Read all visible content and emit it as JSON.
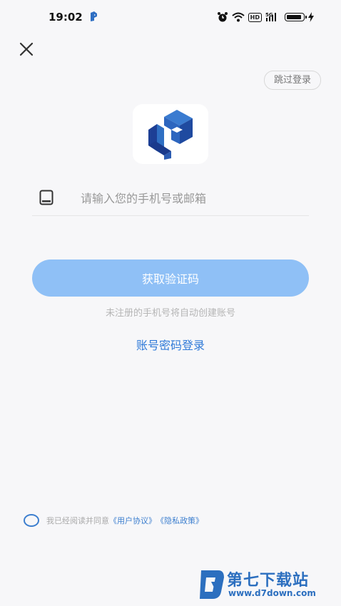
{
  "status_bar": {
    "time": "19:02",
    "hd_badge": "HD",
    "network": "5G",
    "icons": [
      "app-notification-icon",
      "alarm-icon",
      "wifi-icon",
      "hd-icon",
      "signal-icon",
      "battery-icon",
      "charging-icon"
    ]
  },
  "nav": {
    "close_icon": "close-icon",
    "skip_label": "跳过登录"
  },
  "logo": {
    "name": "app-logo",
    "colors": [
      "#2f6fc3",
      "#1d3f95"
    ]
  },
  "form": {
    "phone_placeholder": "请输入您的手机号或邮箱",
    "phone_value": ""
  },
  "actions": {
    "get_code_label": "获取验证码",
    "hint": "未注册的手机号将自动创建账号",
    "password_login_label": "账号密码登录"
  },
  "agreement": {
    "prefix": "我已经阅读并同意",
    "user_agreement": "《用户协议》",
    "privacy_policy": "《隐私政策》"
  },
  "watermark": {
    "title": "第七下载站",
    "url": "www.d7down.com"
  },
  "colors": {
    "background": "#f7f7f9",
    "primary_button": "#8fc0f6",
    "link": "#2f7ad8",
    "hint": "#b5b5b5"
  }
}
